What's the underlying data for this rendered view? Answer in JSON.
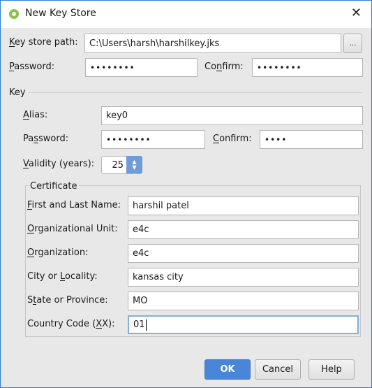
{
  "window": {
    "title": "New Key Store",
    "close_icon": "close-icon",
    "app_icon": "android-studio-icon"
  },
  "keystore": {
    "path_label": {
      "text": "Key store path:",
      "mn": 0
    },
    "path_value": "C:\\Users\\harsh\\harshilkey.jks",
    "browse_label": "...",
    "password_label": {
      "text": "Password:",
      "mn": 0
    },
    "password_value": "••••••••",
    "confirm_label": {
      "text": "Confirm:",
      "mn": 2
    },
    "confirm_value": "••••••••"
  },
  "key": {
    "section_label": "Key",
    "alias_label": {
      "text": "Alias:",
      "mn": 0
    },
    "alias_value": "key0",
    "password_label": {
      "text": "Password:",
      "mn": 2
    },
    "password_value": "••••••••",
    "confirm_label": {
      "text": "Confirm:",
      "mn": 0
    },
    "confirm_value": "••••",
    "validity_label": {
      "text": "Validity (years):",
      "mn": 0
    },
    "validity_value": "25"
  },
  "certificate": {
    "legend": "Certificate",
    "fields": [
      {
        "label": {
          "text": "First and Last Name:",
          "mn": 0
        },
        "value": "harshil patel"
      },
      {
        "label": {
          "text": "Organizational Unit:",
          "mn": 0
        },
        "value": "e4c"
      },
      {
        "label": {
          "text": "Organization:",
          "mn": 0
        },
        "value": "e4c"
      },
      {
        "label": {
          "text": "City or Locality:",
          "mn": 8
        },
        "value": "kansas city"
      },
      {
        "label": {
          "text": "State or Province:",
          "mn": 1
        },
        "value": "MO"
      },
      {
        "label": {
          "text": "Country Code (XX):",
          "mn": 14
        },
        "value": "01"
      }
    ]
  },
  "buttons": {
    "ok": "OK",
    "cancel": "Cancel",
    "help": "Help"
  },
  "colors": {
    "accent": "#4a86d8",
    "window_border": "#2b7fd4"
  }
}
